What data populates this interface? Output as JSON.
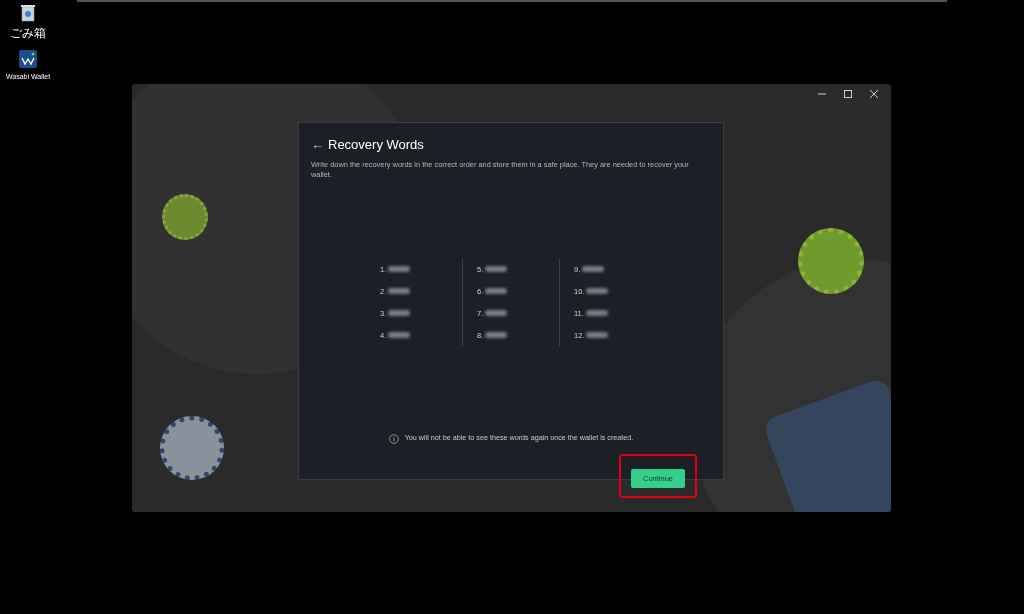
{
  "desktop_icons": [
    {
      "label": "ごみ箱",
      "kind": "trash"
    },
    {
      "label": "Wasabi Wallet",
      "kind": "app"
    }
  ],
  "dialog": {
    "back_glyph": "←",
    "title": "Recovery Words",
    "description": "Write down the recovery words in the correct order and store them in a safe place. They are needed to recover your wallet.",
    "word_columns": [
      [
        "1.",
        "2.",
        "3.",
        "4."
      ],
      [
        "5.",
        "6.",
        "7.",
        "8."
      ],
      [
        "9.",
        "10.",
        "11.",
        "12."
      ]
    ],
    "notice": "You will not be able to see these words again once the wallet is created.",
    "continue_button": {
      "label": "Continue",
      "highlighted": true
    }
  }
}
